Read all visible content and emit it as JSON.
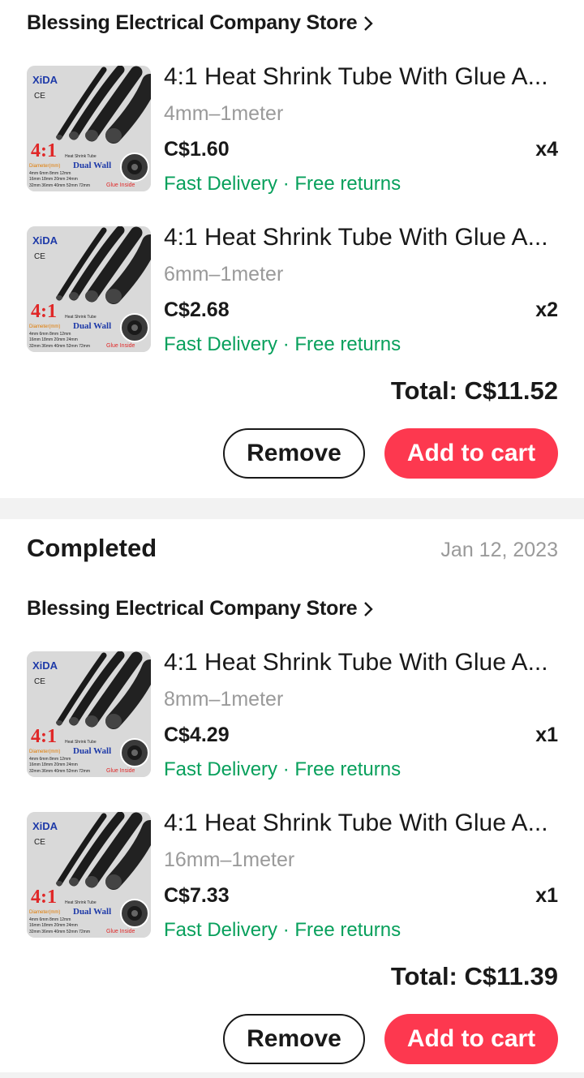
{
  "colors": {
    "accent": "#fd384f",
    "delivery": "#08a05c",
    "muted": "#9a9a9a"
  },
  "orders": [
    {
      "status": "",
      "date": "",
      "store": "Blessing Electrical Company Store",
      "items": [
        {
          "title": "4:1 Heat Shrink Tube With Glue A...",
          "variant": "4mm–1meter",
          "price": "C$1.60",
          "qty": "x4",
          "delivery": "Fast Delivery · Free returns"
        },
        {
          "title": "4:1 Heat Shrink Tube With Glue A...",
          "variant": "6mm–1meter",
          "price": "C$2.68",
          "qty": "x2",
          "delivery": "Fast Delivery · Free returns"
        }
      ],
      "total": "Total: C$11.52",
      "remove_label": "Remove",
      "cart_label": "Add to cart"
    },
    {
      "status": "Completed",
      "date": "Jan 12, 2023",
      "store": "Blessing Electrical Company Store",
      "items": [
        {
          "title": "4:1 Heat Shrink Tube With Glue A...",
          "variant": "8mm–1meter",
          "price": "C$4.29",
          "qty": "x1",
          "delivery": "Fast Delivery · Free returns"
        },
        {
          "title": "4:1 Heat Shrink Tube With Glue A...",
          "variant": "16mm–1meter",
          "price": "C$7.33",
          "qty": "x1",
          "delivery": "Fast Delivery · Free returns"
        }
      ],
      "total": "Total: C$11.39",
      "remove_label": "Remove",
      "cart_label": "Add to cart"
    }
  ],
  "thumbnail": {
    "brand": "XiDA",
    "ce": "CE",
    "ratio": "4:1",
    "line1": "Heat Shrink Tube",
    "line2": "Diameter(mm)",
    "dual": "Dual Wall",
    "sizes1": "4mm 6mm 8mm 12mm",
    "sizes2": "16mm 18mm 20mm 24mm",
    "sizes3": "32mm 36mm 40mm 52mm 72mm",
    "glue": "Glue Inside"
  }
}
